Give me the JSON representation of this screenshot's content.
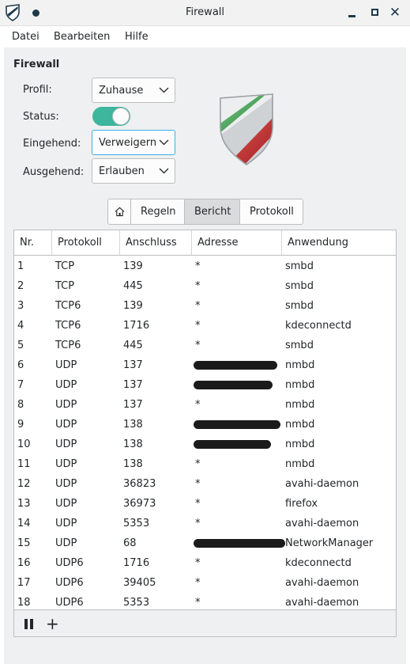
{
  "window": {
    "title": "Firewall"
  },
  "menu": {
    "items": [
      "Datei",
      "Bearbeiten",
      "Hilfe"
    ]
  },
  "group": {
    "title": "Firewall"
  },
  "form": {
    "profile_label": "Profil:",
    "profile_value": "Zuhause",
    "status_label": "Status:",
    "status_on": true,
    "incoming_label": "Eingehend:",
    "incoming_value": "Verweigern",
    "outgoing_label": "Ausgehend:",
    "outgoing_value": "Erlauben"
  },
  "tabs": {
    "items": [
      "Regeln",
      "Bericht",
      "Protokoll"
    ],
    "active": "Bericht"
  },
  "table": {
    "headers": [
      "Nr.",
      "Protokoll",
      "Anschluss",
      "Adresse",
      "Anwendung"
    ],
    "rows": [
      [
        "1",
        "TCP",
        "139",
        "*",
        "smbd"
      ],
      [
        "2",
        "TCP",
        "445",
        "*",
        "smbd"
      ],
      [
        "3",
        "TCP6",
        "139",
        "*",
        "smbd"
      ],
      [
        "4",
        "TCP6",
        "1716",
        "*",
        "kdeconnectd"
      ],
      [
        "5",
        "TCP6",
        "445",
        "*",
        "smbd"
      ],
      [
        "6",
        "UDP",
        "137",
        "",
        "nmbd"
      ],
      [
        "7",
        "UDP",
        "137",
        "",
        "nmbd"
      ],
      [
        "8",
        "UDP",
        "137",
        "*",
        "nmbd"
      ],
      [
        "9",
        "UDP",
        "138",
        "",
        "nmbd"
      ],
      [
        "10",
        "UDP",
        "138",
        "",
        "nmbd"
      ],
      [
        "11",
        "UDP",
        "138",
        "*",
        "nmbd"
      ],
      [
        "12",
        "UDP",
        "36823",
        "*",
        "avahi-daemon"
      ],
      [
        "13",
        "UDP",
        "36973",
        "*",
        "firefox"
      ],
      [
        "14",
        "UDP",
        "5353",
        "*",
        "avahi-daemon"
      ],
      [
        "15",
        "UDP",
        "68",
        "",
        "NetworkManager"
      ],
      [
        "16",
        "UDP6",
        "1716",
        "*",
        "kdeconnectd"
      ],
      [
        "17",
        "UDP6",
        "39405",
        "*",
        "avahi-daemon"
      ],
      [
        "18",
        "UDP6",
        "5353",
        "*",
        "avahi-daemon"
      ]
    ]
  },
  "icons": {
    "app": "shield-icon",
    "home": "home-icon",
    "pause": "pause-icon",
    "add": "plus-icon"
  },
  "colors": {
    "toggle_on": "#3eb59d",
    "focus": "#3daee9",
    "shield_green": "#3a9a4a",
    "shield_red": "#c03030"
  }
}
